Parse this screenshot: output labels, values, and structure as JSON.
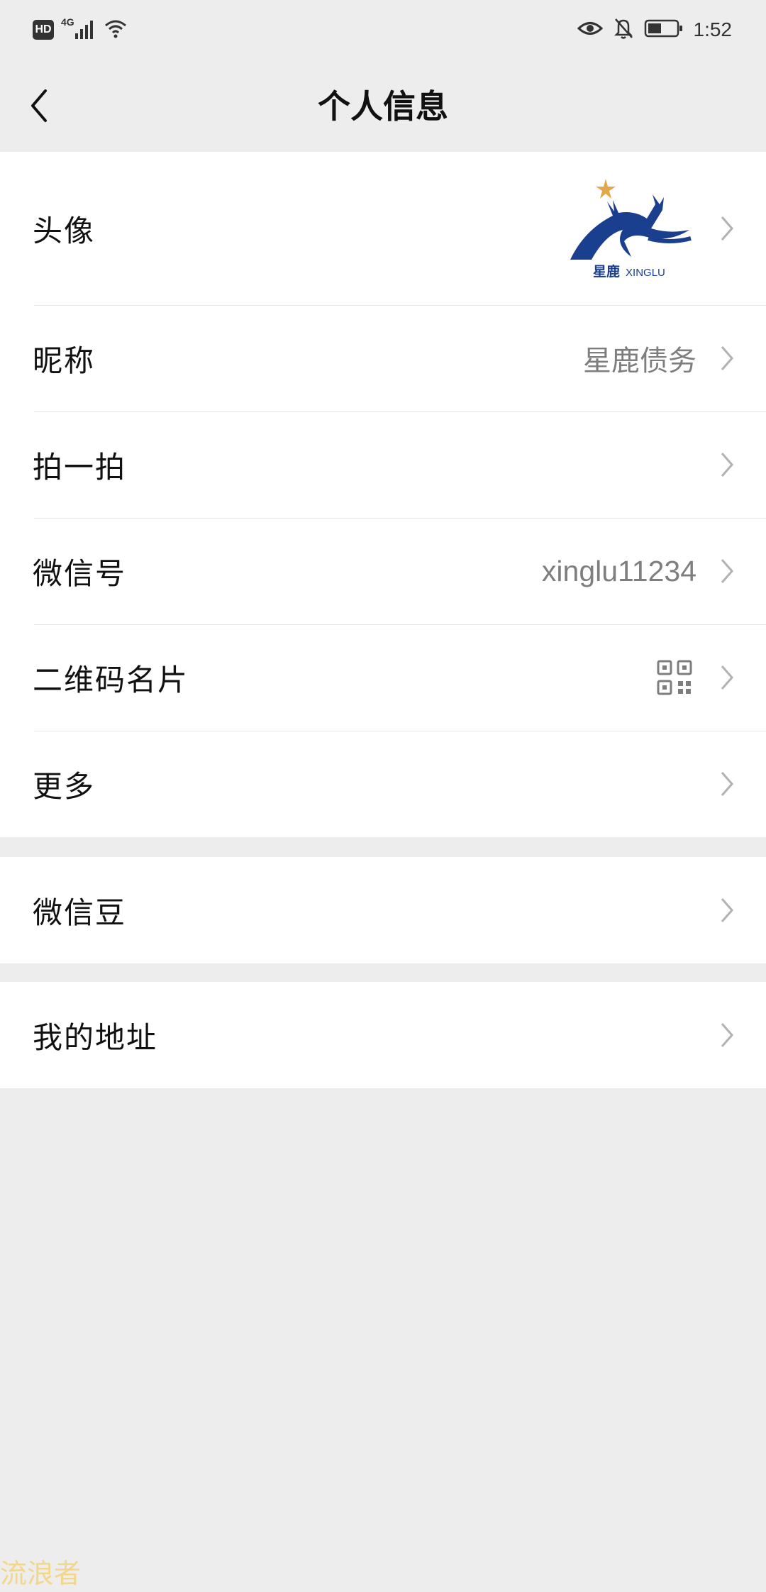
{
  "status_bar": {
    "hd": "HD",
    "network": "4G",
    "time": "1:52"
  },
  "nav": {
    "title": "个人信息"
  },
  "profile_rows": [
    {
      "label": "头像",
      "value": null
    },
    {
      "label": "昵称",
      "value": "星鹿债务"
    },
    {
      "label": "拍一拍",
      "value": null
    },
    {
      "label": "微信号",
      "value": "xinglu11234"
    },
    {
      "label": "二维码名片",
      "value": null
    },
    {
      "label": "更多",
      "value": null
    }
  ],
  "avatar": {
    "logo_cn": "星鹿",
    "logo_en": "XINGLU"
  },
  "beans_row": {
    "label": "微信豆"
  },
  "address_row": {
    "label": "我的地址"
  },
  "watermark": "流浪者",
  "colors": {
    "background": "#ededed",
    "row": "#ffffff",
    "value_text": "#7e7e7e",
    "logo_blue": "#1a3f8f",
    "logo_star": "#e0a84a"
  }
}
